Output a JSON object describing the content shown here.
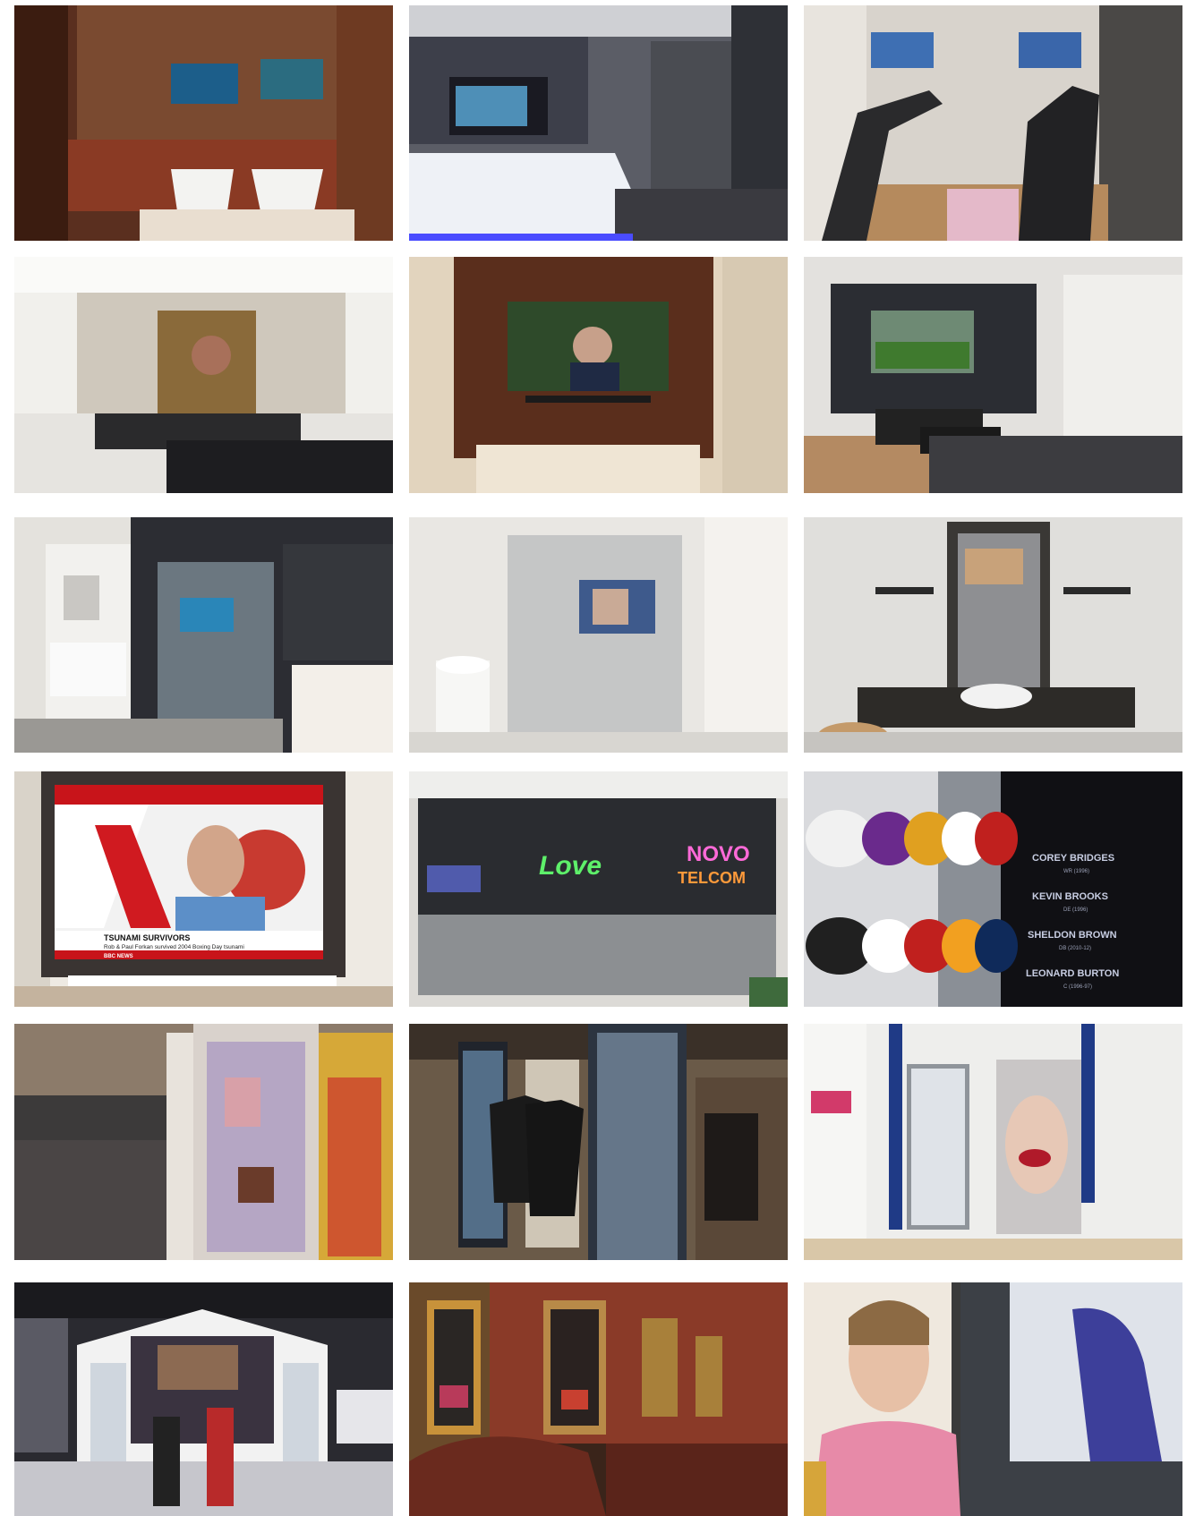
{
  "gallery": {
    "tiles": [
      {
        "subject": "bathroom-mirror-tv-double-sinks"
      },
      {
        "subject": "bathroom-tv-over-bathtub"
      },
      {
        "subject": "home-gym-mirror-tvs"
      },
      {
        "subject": "kitchen-mirror-tv-over-hob"
      },
      {
        "subject": "walnut-panel-wall-tv"
      },
      {
        "subject": "showroom-living-room-mirror-tv"
      },
      {
        "subject": "showroom-shower-glass-tv"
      },
      {
        "subject": "shower-enclosure-tv"
      },
      {
        "subject": "salon-mirror-tv"
      },
      {
        "subject": "news-broadcast-mirror-display",
        "ticker": "TSUNAMI SURVIVORS",
        "subticker": "Rob & Paul Forkan survived 2004 Boxing Day tsunami",
        "channel": "BBC NEWS"
      },
      {
        "subject": "retail-mirror-wall-neon",
        "neon_left": "Love",
        "neon_right_1": "NOVO",
        "neon_right_2": "TELCOM"
      },
      {
        "subject": "football-helmets-mirror-display",
        "names": [
          {
            "name": "COREY BRIDGES",
            "detail": "WR (1996)"
          },
          {
            "name": "KEVIN BROOKS",
            "detail": "DE (1996)"
          },
          {
            "name": "SHELDON BROWN",
            "detail": "DB (2010-12)"
          },
          {
            "name": "LEONARD BURTON",
            "detail": "C (1996-97)"
          }
        ]
      },
      {
        "subject": "duty-free-digital-column"
      },
      {
        "subject": "fashion-store-mirror-panels"
      },
      {
        "subject": "fitting-room-mirror-display"
      },
      {
        "subject": "motor-show-interactive-kiosk"
      },
      {
        "subject": "restaurant-mirror-tvs"
      },
      {
        "subject": "woman-touching-mirror-display"
      }
    ]
  }
}
